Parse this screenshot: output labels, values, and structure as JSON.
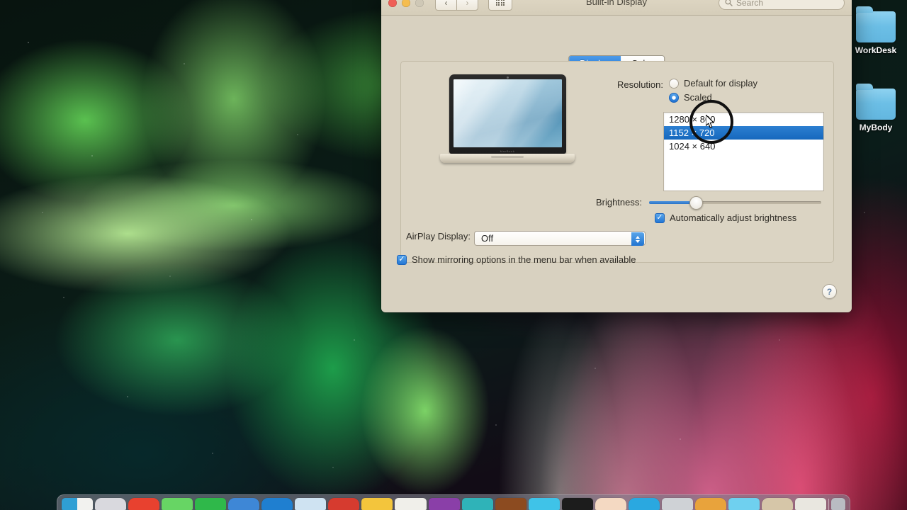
{
  "window": {
    "title": "Built-in Display",
    "traffic_lights": [
      "close",
      "minimize",
      "zoom"
    ],
    "nav": {
      "back": "‹",
      "forward": "›",
      "grid": "grid-view"
    },
    "search": {
      "placeholder": "Search",
      "value": ""
    }
  },
  "tabs": [
    {
      "label": "Display",
      "active": true
    },
    {
      "label": "Color",
      "active": false
    }
  ],
  "display_pane": {
    "resolution": {
      "label": "Resolution:",
      "options": [
        {
          "label": "Default for display",
          "selected": false
        },
        {
          "label": "Scaled",
          "selected": true
        }
      ],
      "scaled_list": [
        {
          "label": "1280 × 800",
          "selected": false
        },
        {
          "label": "1152 × 720",
          "selected": true
        },
        {
          "label": "1024 × 640",
          "selected": false
        }
      ]
    },
    "brightness": {
      "label": "Brightness:",
      "value_percent": 27,
      "auto_adjust": {
        "label": "Automatically adjust brightness",
        "checked": true
      }
    },
    "laptop_logo": "MacBook"
  },
  "airplay": {
    "label": "AirPlay Display:",
    "value": "Off",
    "options": [
      "Off"
    ]
  },
  "mirroring": {
    "label": "Show mirroring options in the menu bar when available",
    "checked": true
  },
  "help": {
    "label": "?"
  },
  "desktop": {
    "icons": [
      {
        "label": "WorkDesk"
      },
      {
        "label": "MyBody"
      }
    ]
  },
  "dock": {
    "icons": [
      {
        "name": "finder",
        "color": "#2f9fd4"
      },
      {
        "name": "launchpad",
        "color": "#d9d9de"
      },
      {
        "name": "app-red",
        "color": "#e8412f"
      },
      {
        "name": "app-green",
        "color": "#67d564"
      },
      {
        "name": "app-green-2",
        "color": "#2fb84a"
      },
      {
        "name": "safari",
        "color": "#3e87d6"
      },
      {
        "name": "browser-blue",
        "color": "#1f7fd0"
      },
      {
        "name": "mail",
        "color": "#cfe3f2"
      },
      {
        "name": "app-red-2",
        "color": "#d63b2f"
      },
      {
        "name": "notes",
        "color": "#f3c53c"
      },
      {
        "name": "app-white",
        "color": "#f0efea"
      },
      {
        "name": "app-purple",
        "color": "#8a3fa8"
      },
      {
        "name": "app-teal",
        "color": "#2fb3b8"
      },
      {
        "name": "app-brown",
        "color": "#8c4b20"
      },
      {
        "name": "app-cyan",
        "color": "#3fc3e8"
      },
      {
        "name": "terminal",
        "color": "#1c1c1c"
      },
      {
        "name": "app-peach",
        "color": "#f4d9c2"
      },
      {
        "name": "app-blue",
        "color": "#2aa8e0"
      },
      {
        "name": "app-grey",
        "color": "#cfd2d6"
      },
      {
        "name": "app-orange",
        "color": "#e8a33c"
      },
      {
        "name": "app-lightblue",
        "color": "#6fd0ef"
      },
      {
        "name": "app-tan",
        "color": "#d6c6a8"
      },
      {
        "name": "finder-window",
        "color": "#e9e7e0"
      },
      {
        "name": "trash",
        "color": "#b9bcc2"
      }
    ]
  },
  "colors": {
    "accent_blue": "#1f72d3",
    "window_bg": "#d8d1c0",
    "selection_blue": "#1668bd"
  }
}
